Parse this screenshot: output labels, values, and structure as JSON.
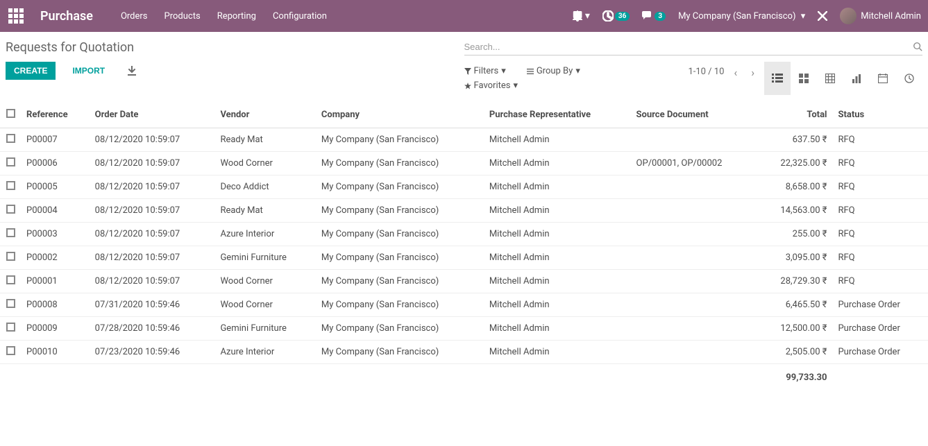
{
  "nav": {
    "brand": "Purchase",
    "menu": [
      "Orders",
      "Products",
      "Reporting",
      "Configuration"
    ],
    "activity_badge": "36",
    "discuss_badge": "3",
    "company": "My Company (San Francisco)",
    "user": "Mitchell Admin"
  },
  "breadcrumb": "Requests for Quotation",
  "search": {
    "placeholder": "Search..."
  },
  "buttons": {
    "create": "CREATE",
    "import": "IMPORT"
  },
  "search_opts": {
    "filters": "Filters",
    "groupby": "Group By",
    "favorites": "Favorites"
  },
  "pager": {
    "value": "1-10 / 10"
  },
  "columns": [
    "Reference",
    "Order Date",
    "Vendor",
    "Company",
    "Purchase Representative",
    "Source Document",
    "Total",
    "Status"
  ],
  "rows": [
    {
      "ref": "P00007",
      "date": "08/12/2020 10:59:07",
      "vendor": "Ready Mat",
      "company": "My Company (San Francisco)",
      "rep": "Mitchell Admin",
      "src": "",
      "total": "637.50 ₹",
      "status": "RFQ"
    },
    {
      "ref": "P00006",
      "date": "08/12/2020 10:59:07",
      "vendor": "Wood Corner",
      "company": "My Company (San Francisco)",
      "rep": "Mitchell Admin",
      "src": "OP/00001, OP/00002",
      "total": "22,325.00 ₹",
      "status": "RFQ"
    },
    {
      "ref": "P00005",
      "date": "08/12/2020 10:59:07",
      "vendor": "Deco Addict",
      "company": "My Company (San Francisco)",
      "rep": "Mitchell Admin",
      "src": "",
      "total": "8,658.00 ₹",
      "status": "RFQ"
    },
    {
      "ref": "P00004",
      "date": "08/12/2020 10:59:07",
      "vendor": "Ready Mat",
      "company": "My Company (San Francisco)",
      "rep": "Mitchell Admin",
      "src": "",
      "total": "14,563.00 ₹",
      "status": "RFQ"
    },
    {
      "ref": "P00003",
      "date": "08/12/2020 10:59:07",
      "vendor": "Azure Interior",
      "company": "My Company (San Francisco)",
      "rep": "Mitchell Admin",
      "src": "",
      "total": "255.00 ₹",
      "status": "RFQ"
    },
    {
      "ref": "P00002",
      "date": "08/12/2020 10:59:07",
      "vendor": "Gemini Furniture",
      "company": "My Company (San Francisco)",
      "rep": "Mitchell Admin",
      "src": "",
      "total": "3,095.00 ₹",
      "status": "RFQ"
    },
    {
      "ref": "P00001",
      "date": "08/12/2020 10:59:07",
      "vendor": "Wood Corner",
      "company": "My Company (San Francisco)",
      "rep": "Mitchell Admin",
      "src": "",
      "total": "28,729.30 ₹",
      "status": "RFQ"
    },
    {
      "ref": "P00008",
      "date": "07/31/2020 10:59:46",
      "vendor": "Wood Corner",
      "company": "My Company (San Francisco)",
      "rep": "Mitchell Admin",
      "src": "",
      "total": "6,465.50 ₹",
      "status": "Purchase Order"
    },
    {
      "ref": "P00009",
      "date": "07/28/2020 10:59:46",
      "vendor": "Gemini Furniture",
      "company": "My Company (San Francisco)",
      "rep": "Mitchell Admin",
      "src": "",
      "total": "12,500.00 ₹",
      "status": "Purchase Order"
    },
    {
      "ref": "P00010",
      "date": "07/23/2020 10:59:46",
      "vendor": "Azure Interior",
      "company": "My Company (San Francisco)",
      "rep": "Mitchell Admin",
      "src": "",
      "total": "2,505.00 ₹",
      "status": "Purchase Order"
    }
  ],
  "footer_total": "99,733.30"
}
